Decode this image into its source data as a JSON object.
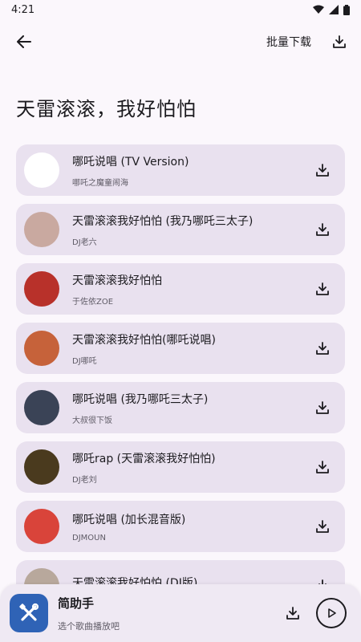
{
  "status": {
    "time": "4:21"
  },
  "header": {
    "batch_download_label": "批量下载"
  },
  "page": {
    "title": "天雷滚滚，我好怕怕"
  },
  "songs": [
    {
      "title": "哪吒说唱 (TV Version)",
      "artist": "哪吒之魔童闹海",
      "cover_color": "#ffffff"
    },
    {
      "title": "天雷滚滚我好怕怕 (我乃哪吒三太子)",
      "artist": "DJ老六",
      "cover_color": "#c9a9a0"
    },
    {
      "title": "天雷滚滚我好怕怕",
      "artist": "于佐依ZOE",
      "cover_color": "#b8312a"
    },
    {
      "title": "天雷滚滚我好怕怕(哪吒说唱)",
      "artist": "DJ哪吒",
      "cover_color": "#c6623a"
    },
    {
      "title": "哪吒说唱 (我乃哪吒三太子)",
      "artist": "大叔很下饭",
      "cover_color": "#3a4356"
    },
    {
      "title": "哪吒rap (天雷滚滚我好怕怕)",
      "artist": "DJ老刘",
      "cover_color": "#4a3a1e"
    },
    {
      "title": "哪吒说唱 (加长混音版)",
      "artist": "DJMOUN",
      "cover_color": "#d9443a"
    },
    {
      "title": "天雷滚滚我好怕怕 (DJ版)",
      "artist": "",
      "cover_color": "#b8a89c"
    }
  ],
  "player": {
    "title": "简助手",
    "subtitle": "选个歌曲播放吧"
  },
  "colors": {
    "card_bg": "#e9e1ef",
    "page_bg": "#fbf7fc",
    "logo_bg": "#2f63b6"
  },
  "icons": {
    "back": "arrow-left-icon",
    "download": "download-icon",
    "play": "play-icon",
    "logo": "tools-icon"
  }
}
